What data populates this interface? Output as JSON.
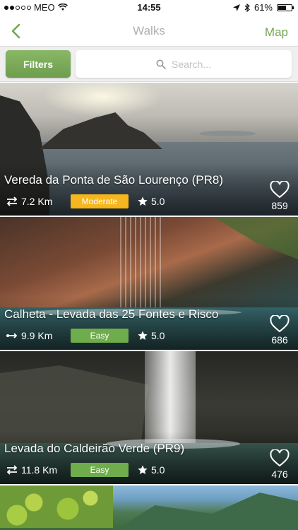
{
  "status_bar": {
    "carrier": "MEO",
    "time": "14:55",
    "battery": "61%",
    "battery_level": 0.61,
    "icons": [
      "signal-dots-icon",
      "wifi-icon",
      "location-arrow-icon",
      "bluetooth-icon",
      "battery-icon"
    ]
  },
  "nav": {
    "back_icon": "chevron-left-icon",
    "title": "Walks",
    "map_label": "Map"
  },
  "filters": {
    "button_label": "Filters",
    "search_placeholder": "Search...",
    "search_icon": "search-icon"
  },
  "colors": {
    "accent": "#74a653",
    "moderate": "#f5b61e",
    "easy": "#6fac4c"
  },
  "walks": [
    {
      "title": "Vereda da Ponta de São Lourenço (PR8)",
      "route_icon": "round-trip-arrows-icon",
      "distance": "7.2 Km",
      "difficulty": "Moderate",
      "rating": "5.0",
      "favorites": "859"
    },
    {
      "title": "Calheta - Levada das 25 Fontes e Risco",
      "route_icon": "one-way-arrow-icon",
      "distance": "9.9 Km",
      "difficulty": "Easy",
      "rating": "5.0",
      "favorites": "686"
    },
    {
      "title": "Levada do Caldeirão Verde (PR9)",
      "route_icon": "round-trip-arrows-icon",
      "distance": "11.8 Km",
      "difficulty": "Easy",
      "rating": "5.0",
      "favorites": "476"
    }
  ]
}
